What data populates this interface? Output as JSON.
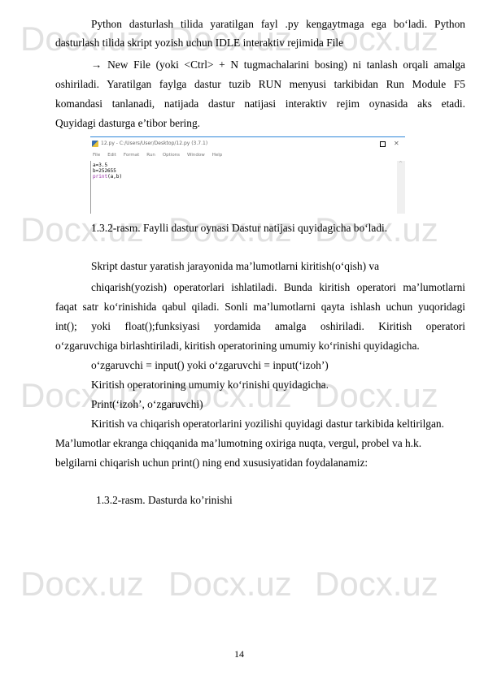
{
  "watermark": {
    "text": "Docx.uz",
    "color": "#e1e1e1"
  },
  "paragraphs": {
    "p1": [
      "Python dasturlash tilida yaratilgan fayl .py kengaytmaga ega bo‘ladi. Python",
      "dasturlash tilida skript yozish uchun IDLE interaktiv rejimida File"
    ],
    "p2": [
      "→ New File (yoki <Ctrl> + N tugmachalarini bosing) ni tanlash orqali amalga",
      "oshiriladi. Yaratilgan faylga dastur tuzib RUN menyusi tarkibidan Run Module F5",
      "komandasi tanlanadi, natijada dastur natijasi interaktiv rejim oynasida aks etadi.",
      "Quyidagi dasturga e’tibor bering."
    ],
    "caption1": "1.3.2-rasm. Faylli dastur oynasi Dastur natijasi quyidagicha bo‘ladi.",
    "p3": "Skript dastur yaratish jarayonida ma’lumotlarni kiritish(o‘qish) va",
    "p4": [
      "chiqarish(yozish) operatorlari ishlatiladi. Bunda kiritish operatori ma’lumotlarni",
      "faqat satr ko‘rinishida qabul qiladi. Sonli ma’lumotlarni qayta ishlash uchun yuqoridagi",
      "int(); yoki float();funksiyasi yordamida amalga oshiriladi. Kiritish operatori",
      "o‘zgaruvchiga birlashtiriladi, kiritish operatorining umumiy ko‘rinishi quyidagicha."
    ],
    "input_syntax": "o‘zgaruvchi = input() yoki o‘zgaruvchi = input(‘izoh’)",
    "output_intro": "Kiritish operatorining umumiy ko‘rinishi quyidagicha.",
    "print_syntax": "Print(‘izoh’, o‘zgaruvchi)",
    "program_intro": "Kiritish va chiqarish operatorlarini yozilishi quyidagi dastur tarkibida keltirilgan.",
    "p5": [
      "Ma’lumotlar ekranga chiqqanida ma’lumotning oxiriga nuqta, vergul, probel va h.k.",
      "belgilarni chiqarish uchun print() ning end xususiyatidan foydalanamiz:"
    ],
    "caption2": "1.3.2-rasm. Dasturda ko’rinishi"
  },
  "idle_window": {
    "title": "12.py - C:/Users/User/Desktop/12.py (3.7.1)",
    "icon": "python-file-icon",
    "menu": [
      "File",
      "Edit",
      "Format",
      "Run",
      "Options",
      "Window",
      "Help"
    ],
    "code": [
      {
        "text": "a=3.5"
      },
      {
        "text": "b=252655"
      },
      {
        "keyword": "print",
        "rest": "(a,b)"
      }
    ],
    "keyword_color": "#9a2fa8",
    "accent_color": "#2e86d9"
  },
  "page_number": "14"
}
